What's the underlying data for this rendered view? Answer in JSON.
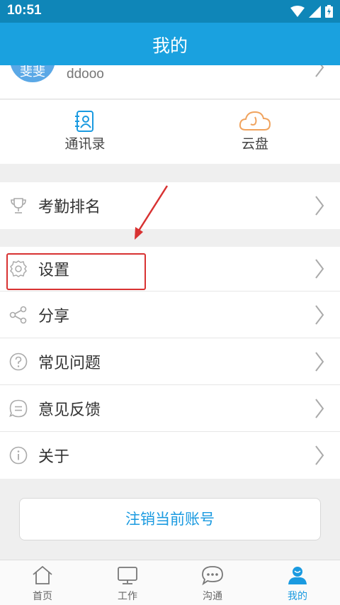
{
  "status_bar": {
    "time": "10:51"
  },
  "app_bar": {
    "title": "我的"
  },
  "profile": {
    "avatar_text": "斐斐",
    "username": "ddooo"
  },
  "quick_links": [
    {
      "label": "通讯录",
      "icon": "contacts-icon"
    },
    {
      "label": "云盘",
      "icon": "cloud-icon"
    }
  ],
  "menu": {
    "attendance_ranking": "考勤排名",
    "settings": "设置",
    "share": "分享",
    "faq": "常见问题",
    "feedback": "意见反馈",
    "about": "关于"
  },
  "logout_label": "注销当前账号",
  "bottom_nav": [
    {
      "label": "首页",
      "icon": "home-icon"
    },
    {
      "label": "工作",
      "icon": "work-icon"
    },
    {
      "label": "沟通",
      "icon": "chat-icon"
    },
    {
      "label": "我的",
      "icon": "me-icon"
    }
  ],
  "colors": {
    "status_bar": "#0f86b8",
    "app_bar": "#1aa1df",
    "accent": "#1a9ae0",
    "annotation": "#d83232",
    "cloud_icon": "#f0a35e"
  }
}
